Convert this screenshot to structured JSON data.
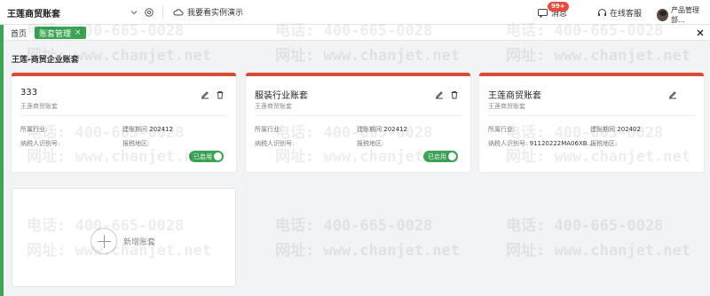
{
  "header": {
    "account_name": "王莲商贸账套",
    "demo_label": "我要看实例演示",
    "messages_label": "消息",
    "messages_badge": "99+",
    "service_label": "在线客服",
    "user_name": "产品管理部..."
  },
  "tabs": {
    "home": "首页",
    "active": "账套管理",
    "active_close": "×"
  },
  "group_title": "王莲-商贸企业账套",
  "fields": {
    "industry": "所属行业:",
    "period": "建账期间",
    "tax_id": "纳税人识别号:",
    "region": "报税地区:"
  },
  "cards": [
    {
      "title": "333",
      "subtitle": "王莲商贸账套",
      "industry_value": "",
      "period_value": "202412",
      "tax_id_value": "",
      "region_value": "",
      "status": "已启用"
    },
    {
      "title": "服装行业账套",
      "subtitle": "王莲商贸账套",
      "industry_value": "",
      "period_value": "202412",
      "tax_id_value": "",
      "region_value": "",
      "status": "已启用"
    },
    {
      "title": "王莲商贸账套",
      "subtitle": "王莲商贸账套",
      "industry_value": "",
      "period_value": "202402",
      "tax_id_value": "91120222MA06XB...",
      "region_value": ""
    }
  ],
  "add_label": "新增账套",
  "watermark": {
    "phone": "电话: 400-665-0028",
    "site": "网址: www.chanjet.net"
  },
  "colors": {
    "brand_green": "#3aa655",
    "card_accent": "#d94b35",
    "badge_red": "#e84a3c"
  },
  "icons": [
    "chevron-down-icon",
    "settings-icon",
    "cloud-icon",
    "message-icon",
    "headset-icon",
    "close-icon",
    "edit-icon",
    "delete-icon",
    "plus-icon"
  ]
}
